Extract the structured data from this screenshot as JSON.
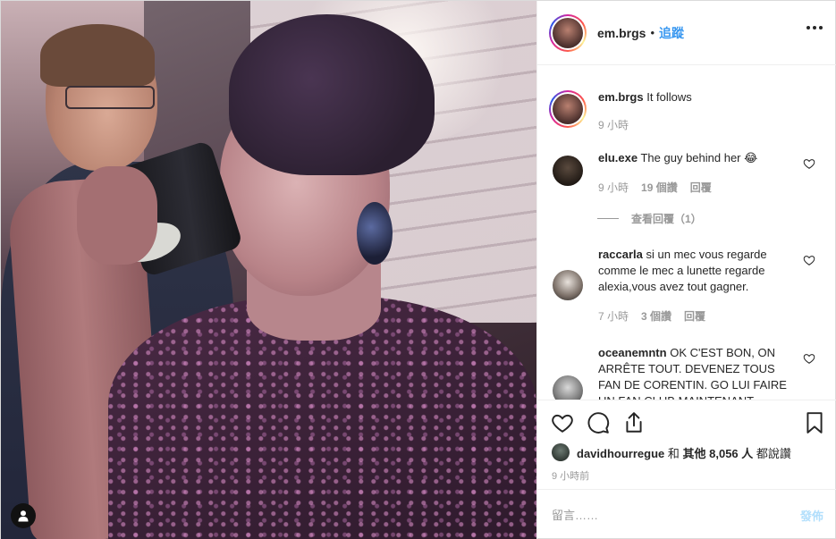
{
  "header": {
    "username": "em.brgs",
    "separator": "•",
    "follow_label": "追蹤"
  },
  "caption": {
    "username": "em.brgs",
    "text": "It follows",
    "time": "9 小時"
  },
  "comments": [
    {
      "username": "elu.exe",
      "text": "The guy behind her 😂",
      "time": "9 小時",
      "likes": "19 個讚",
      "reply_label": "回覆"
    },
    {
      "username": "raccarla",
      "text": "si un mec vous regarde comme le mec a lunette regarde alexia,vous avez tout gagner.",
      "time": "7 小時",
      "likes": "3 個讚",
      "reply_label": "回覆"
    },
    {
      "username": "oceanemntn",
      "text": "OK C'EST BON, ON ARRÊTE TOUT. DEVENEZ TOUS FAN DE CORENTIN. GO LUI FAIRE UN FAN CLUB MAINTENANT"
    }
  ],
  "view_replies_label": "查看回覆（1）",
  "likes": {
    "user": "davidhourregue",
    "connector": "和",
    "others": "其他 8,056 人",
    "suffix": "都說讚"
  },
  "post_time": "9 小時前",
  "add_comment": {
    "placeholder": "留言……",
    "post_label": "發佈"
  },
  "colors": {
    "follow": "#3897f0",
    "post_disabled": "#b2dffc",
    "meta": "#999999"
  },
  "icons": {
    "like": "heart-icon",
    "comment": "comment-icon",
    "share": "share-icon",
    "save": "bookmark-icon",
    "more": "more-options-icon",
    "tag": "user-tag-icon"
  }
}
